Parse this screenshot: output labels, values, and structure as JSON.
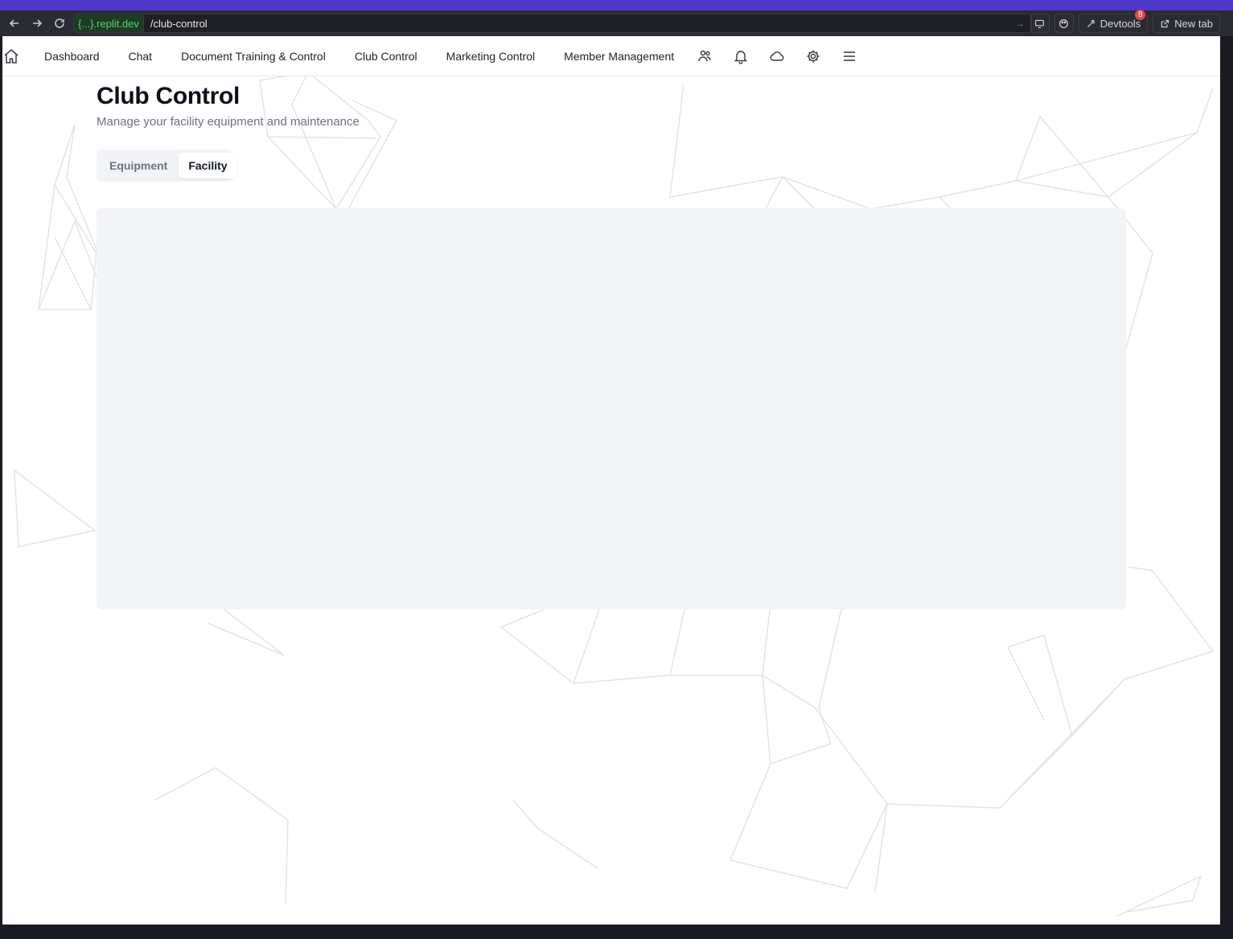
{
  "browser": {
    "url_host": "{...}.replit.dev",
    "url_path": "/club-control",
    "devtools_label": "Devtools",
    "devtools_badge": "8",
    "new_tab_label": "New tab"
  },
  "nav": {
    "links": [
      "Dashboard",
      "Chat",
      "Document Training & Control",
      "Club Control",
      "Marketing Control",
      "Member Management"
    ],
    "icons": [
      "users-icon",
      "bell-icon",
      "cloud-icon",
      "gear-icon",
      "menu-icon"
    ]
  },
  "page": {
    "title": "Club Control",
    "subtitle": "Manage your facility equipment and maintenance",
    "tabs": [
      {
        "label": "Equipment",
        "active": false
      },
      {
        "label": "Facility",
        "active": true
      }
    ]
  },
  "colors": {
    "top_strip": "#4f38c9",
    "browser_bar": "#2b2c33",
    "panel": "#f1f4f7",
    "background_lines": "#e4e4e7"
  }
}
